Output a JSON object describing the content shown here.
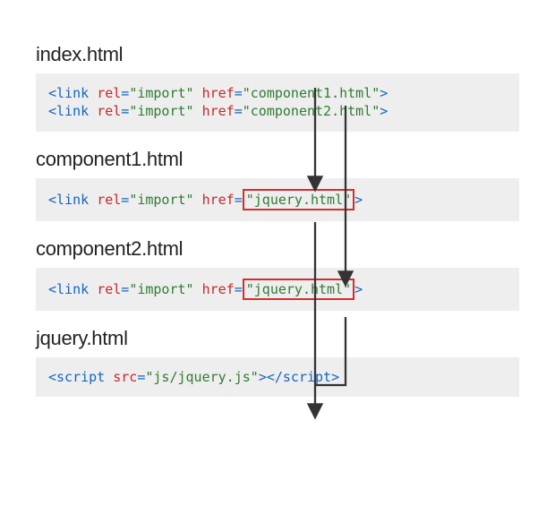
{
  "sections": {
    "index": {
      "title": "index.html",
      "lines": [
        {
          "tag": "link",
          "rel": "import",
          "href": "component1.html"
        },
        {
          "tag": "link",
          "rel": "import",
          "href": "component2.html"
        }
      ]
    },
    "component1": {
      "title": "component1.html",
      "lines": [
        {
          "tag": "link",
          "rel": "import",
          "href": "jquery.html",
          "highlight_href": true
        }
      ]
    },
    "component2": {
      "title": "component2.html",
      "lines": [
        {
          "tag": "link",
          "rel": "import",
          "href": "jquery.html",
          "highlight_href": true
        }
      ]
    },
    "jquery": {
      "title": "jquery.html",
      "lines": [
        {
          "script_tag": true,
          "src": "js/jquery.js"
        }
      ]
    }
  },
  "quote": "\"",
  "rel_label": "rel",
  "href_label": "href",
  "src_label": "src",
  "script_tag_name": "script",
  "link_tag_name": "link",
  "equals": "="
}
